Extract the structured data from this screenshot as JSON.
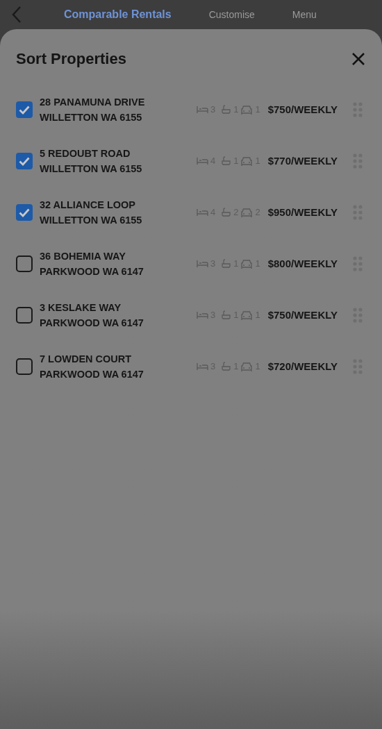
{
  "header": {
    "tabs": [
      {
        "label": "Comparable Rentals",
        "selected": true
      },
      {
        "label": "Customise",
        "selected": false
      },
      {
        "label": "Menu",
        "selected": false
      }
    ]
  },
  "sheet": {
    "title": "Sort Properties",
    "properties": [
      {
        "street": "28 PANAMUNA DRIVE",
        "suburb": "WILLETTON WA 6155",
        "beds": "3",
        "baths": "1",
        "cars": "1",
        "price": "$750/WEEKLY",
        "checked": true
      },
      {
        "street": "5 REDOUBT ROAD",
        "suburb": "WILLETTON WA 6155",
        "beds": "4",
        "baths": "1",
        "cars": "1",
        "price": "$770/WEEKLY",
        "checked": true
      },
      {
        "street": "32 ALLIANCE LOOP",
        "suburb": "WILLETTON WA 6155",
        "beds": "4",
        "baths": "2",
        "cars": "2",
        "price": "$950/WEEKLY",
        "checked": true
      },
      {
        "street": "36 BOHEMIA WAY",
        "suburb": "PARKWOOD WA 6147",
        "beds": "3",
        "baths": "1",
        "cars": "1",
        "price": "$800/WEEKLY",
        "checked": false
      },
      {
        "street": "3 KESLAKE WAY",
        "suburb": "PARKWOOD WA 6147",
        "beds": "3",
        "baths": "1",
        "cars": "1",
        "price": "$750/WEEKLY",
        "checked": false
      },
      {
        "street": "7 LOWDEN COURT",
        "suburb": "PARKWOOD WA 6147",
        "beds": "3",
        "baths": "1",
        "cars": "1",
        "price": "$720/WEEKLY",
        "checked": false
      }
    ]
  }
}
